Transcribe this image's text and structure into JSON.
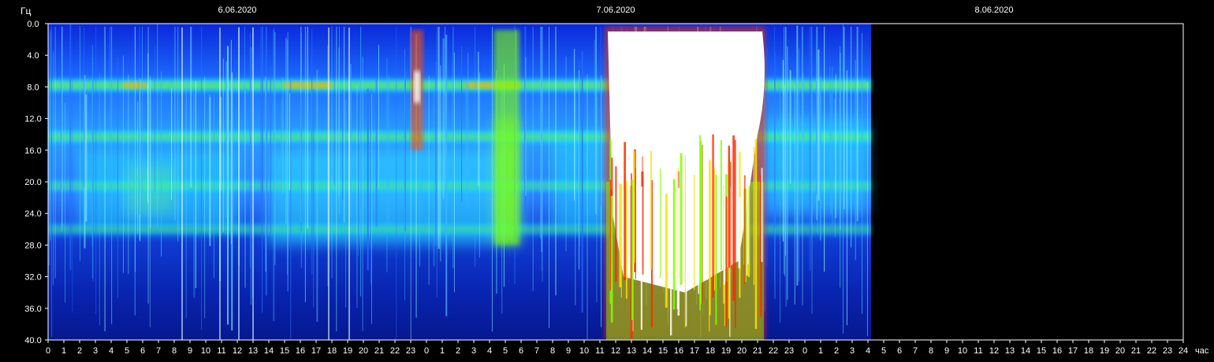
{
  "chart_data": {
    "type": "heatmap",
    "title": "",
    "ylabel": "Гц",
    "xlabel": "час",
    "ylim": [
      0,
      40
    ],
    "y_ticks": [
      "0.0",
      "4.0",
      "8.0",
      "12.0",
      "16.0",
      "20.0",
      "24.0",
      "28.0",
      "32.0",
      "36.0",
      "40.0"
    ],
    "x_ticks": [
      "0",
      "1",
      "2",
      "3",
      "4",
      "5",
      "6",
      "7",
      "8",
      "9",
      "10",
      "11",
      "12",
      "13",
      "14",
      "15",
      "16",
      "17",
      "18",
      "19",
      "20",
      "21",
      "22",
      "23",
      "0",
      "1",
      "2",
      "3",
      "4",
      "5",
      "6",
      "7",
      "8",
      "9",
      "10",
      "11",
      "12",
      "13",
      "14",
      "15",
      "16",
      "17",
      "18",
      "19",
      "20",
      "21",
      "22",
      "23",
      "0",
      "1",
      "2",
      "3",
      "4",
      "5",
      "6",
      "7",
      "8",
      "9",
      "10",
      "11",
      "12",
      "13",
      "14",
      "15",
      "16",
      "17",
      "18",
      "19",
      "20",
      "21",
      "22",
      "23",
      "24"
    ],
    "dates": [
      {
        "label": "6.06.2020",
        "hour": 12
      },
      {
        "label": "7.06.2020",
        "hour": 36
      },
      {
        "label": "8.06.2020",
        "hour": 60
      }
    ],
    "xlim_hours": [
      0,
      72
    ],
    "data_end_hour": 52.2,
    "bands_hz": [
      {
        "freq": 7.8,
        "intensity": 0.75
      },
      {
        "freq": 14.3,
        "intensity": 0.55
      },
      {
        "freq": 20.5,
        "intensity": 0.4
      },
      {
        "freq": 26.0,
        "intensity": 0.35
      }
    ],
    "events": [
      {
        "start_hour": 23.0,
        "end_hour": 23.8,
        "max_freq": 16,
        "intensity": 0.8
      },
      {
        "start_hour": 28.3,
        "end_hour": 29.9,
        "max_freq": 28,
        "intensity": 0.5
      },
      {
        "start_hour": 35.5,
        "end_hour": 45.3,
        "max_freq": 40,
        "intensity": 1.0
      }
    ],
    "colors": {
      "background": "#000000",
      "low": "#00008b",
      "mid_low": "#1e50ff",
      "mid": "#00e5ff",
      "mid_high": "#7fff00",
      "high": "#ff3000",
      "peak": "#ffffff"
    }
  }
}
